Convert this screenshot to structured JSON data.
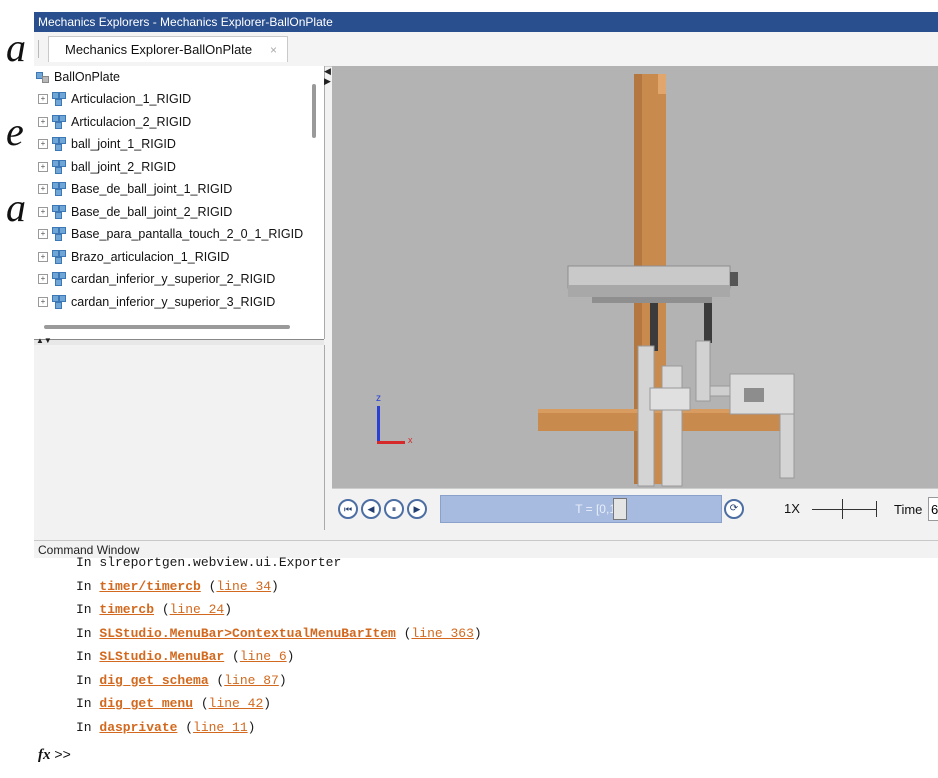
{
  "window": {
    "title": "Mechanics Explorers - Mechanics Explorer-BallOnPlate"
  },
  "tab": {
    "label": "Mechanics Explorer-BallOnPlate",
    "close": "×"
  },
  "doc_fragment": [
    "a",
    "e",
    "a"
  ],
  "tree": {
    "root": "BallOnPlate",
    "items": [
      "Articulacion_1_RIGID",
      "Articulacion_2_RIGID",
      "ball_joint_1_RIGID",
      "ball_joint_2_RIGID",
      "Base_de_ball_joint_1_RIGID",
      "Base_de_ball_joint_2_RIGID",
      "Base_para_pantalla_touch_2_0_1_RIGID",
      "Brazo_articulacion_1_RIGID",
      "cardan_inferior_y_superior_2_RIGID",
      "cardan_inferior_y_superior_3_RIGID"
    ]
  },
  "viewport": {
    "axis_z": "z",
    "axis_x": "x"
  },
  "playback": {
    "buttons": [
      "⏮",
      "◀",
      "⏸",
      "▶"
    ],
    "timeline_label": "T = [0,10]",
    "loop_icon": "⟳",
    "speed": "1X",
    "time_label": "Time",
    "time_value": "6"
  },
  "command_window": {
    "title": "Command Window",
    "lines": [
      {
        "prefix": "In ",
        "name": "slreportgen.webview.ui.Exporter",
        "line": "",
        "plain": true
      },
      {
        "prefix": "In ",
        "name": "timer/timercb",
        "line": "line 34"
      },
      {
        "prefix": "In ",
        "name": "timercb",
        "line": "line 24"
      },
      {
        "prefix": "In ",
        "name": "SLStudio.MenuBar>ContextualMenuBarItem",
        "line": "line 363"
      },
      {
        "prefix": "In ",
        "name": "SLStudio.MenuBar",
        "line": "line 6"
      },
      {
        "prefix": "In ",
        "name": "dig_get_schema",
        "line": "line 87"
      },
      {
        "prefix": "In ",
        "name": "dig_get_menu",
        "line": "line 42"
      },
      {
        "prefix": "In ",
        "name": "dasprivate",
        "line": "line 11"
      }
    ],
    "prompt_symbol": "fx",
    "prompt": ">>"
  },
  "colors": {
    "titlebar": "#2a4f8f",
    "viewport_bg": "#b3b3b3",
    "copper": "#c98a4e",
    "link_orange": "#d2691e",
    "timeline": "#a7badf"
  }
}
